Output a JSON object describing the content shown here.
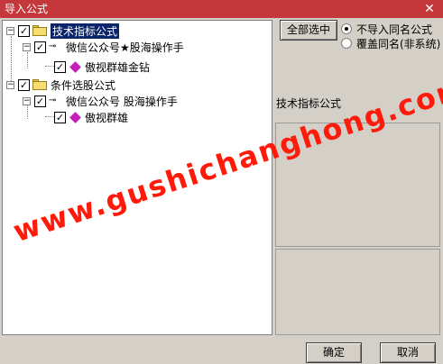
{
  "window": {
    "title": "导入公式",
    "close_label": "✕"
  },
  "tree": {
    "nodes": [
      {
        "label": "技术指标公式",
        "kind": "folder",
        "checked": true,
        "selected": true
      },
      {
        "label": "微信公众号★股海操作手",
        "kind": "key",
        "checked": true
      },
      {
        "label": "傲视群雄金钻",
        "kind": "diamond",
        "checked": true
      },
      {
        "label": "条件选股公式",
        "kind": "folder",
        "checked": true
      },
      {
        "label": "微信公众号 股海操作手",
        "kind": "key",
        "checked": true
      },
      {
        "label": "傲视群雄",
        "kind": "diamond",
        "checked": true
      }
    ]
  },
  "options": {
    "select_all_label": "全部选中",
    "radio_no_import": "不导入同名公式",
    "radio_overwrite": "覆盖同名(非系统)"
  },
  "formula_panel": {
    "label": "技术指标公式"
  },
  "watermark": "www.gushichanghong.com",
  "buttons": {
    "ok": "确定",
    "cancel": "取消"
  }
}
